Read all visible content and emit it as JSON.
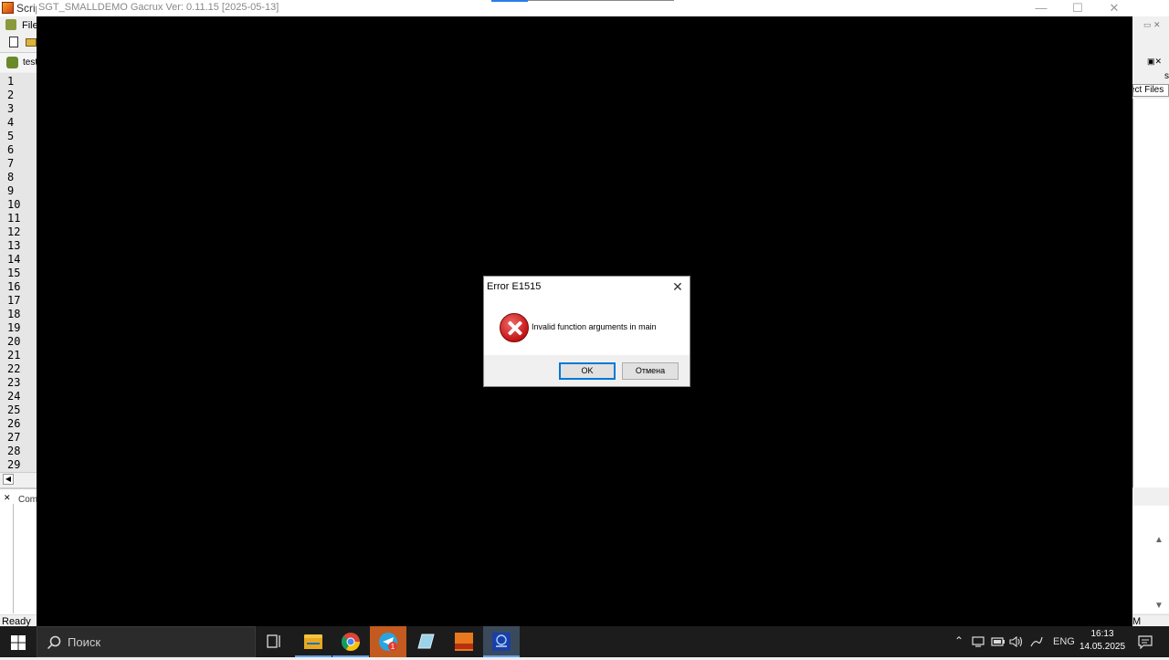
{
  "ide": {
    "title": "Scrip",
    "menu_file": "File",
    "tab_label": "test",
    "line_numbers": [
      "1",
      "2",
      "3",
      "4",
      "5",
      "6",
      "7",
      "8",
      "9",
      "10",
      "11",
      "12",
      "13",
      "14",
      "15",
      "16",
      "17",
      "18",
      "19",
      "20",
      "21",
      "22",
      "23",
      "24",
      "25",
      "26",
      "27",
      "28",
      "29"
    ],
    "bottom_panel_label": "Comm",
    "status": "Ready",
    "status_right": "M",
    "right_panel": {
      "tab_top": "s",
      "project_files": "ect Files"
    }
  },
  "console": {
    "title": "SGT_SMALLDEMO  Gacrux  Ver: 0.11.15  [2025-05-13]"
  },
  "dialog": {
    "title": "Error E1515",
    "message": "Invalid function arguments in main",
    "ok_label": "OK",
    "cancel_label": "Отмена",
    "close_glyph": "✕"
  },
  "taskbar": {
    "search_placeholder": "Поиск",
    "language": "ENG",
    "time": "16:13",
    "date": "14.05.2025",
    "badge": "1"
  },
  "colors": {
    "console_bg": "#000000",
    "taskbar_bg": "#1c1c1c",
    "accent": "#0078d7",
    "error_red": "#c41414"
  }
}
